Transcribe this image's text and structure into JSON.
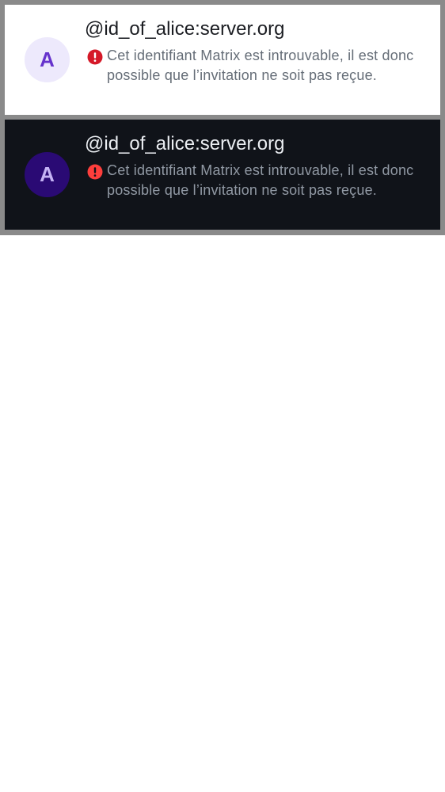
{
  "items": [
    {
      "theme": "light",
      "avatar_letter": "A",
      "user_id": "@id_of_alice:server.org",
      "warning_text": "Cet identifiant Matrix est introuvable, il est donc possible que l’invitation ne soit pas reçue.",
      "warning_icon_color": "#d51928",
      "avatar_bg": "#ede9fc",
      "avatar_fg": "#6633cc"
    },
    {
      "theme": "dark",
      "avatar_letter": "A",
      "user_id": "@id_of_alice:server.org",
      "warning_text": "Cet identifiant Matrix est introuvable, il est donc possible que l’invitation ne soit pas reçue.",
      "warning_icon_color": "#fd3e3c",
      "avatar_bg": "#2a0a74",
      "avatar_fg": "#c5b3f5"
    }
  ],
  "icons": {
    "warning": "error-icon"
  }
}
